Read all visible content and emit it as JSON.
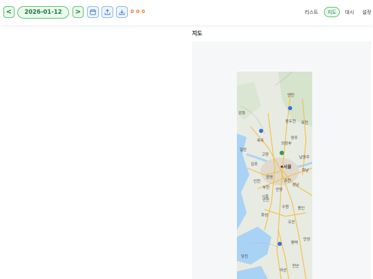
{
  "toolbar": {
    "prev_label": "<",
    "date": "2026-01-12",
    "next_label": ">",
    "icons": [
      "calendar-icon",
      "upload-icon",
      "download-icon"
    ],
    "counts": [
      "0",
      "0",
      "0"
    ],
    "counts_color": "#e8752e"
  },
  "views": {
    "list": "리스트",
    "map": "지도",
    "dashboard": "대시",
    "settings": "설정",
    "active": "map"
  },
  "map_section": {
    "title": "지도",
    "labels": [
      "연천",
      "포천",
      "동두천",
      "양주",
      "파주",
      "의정부",
      "고양",
      "남양주",
      "서울",
      "하남",
      "김포",
      "인천",
      "광명",
      "과천",
      "성남",
      "안양",
      "부천",
      "시흥",
      "안산",
      "수원",
      "화성",
      "용인",
      "오산",
      "평택",
      "안성",
      "당진",
      "아산",
      "천안",
      "강화",
      "일산"
    ]
  },
  "colors": {
    "accent_green": "#5cc16f",
    "accent_blue": "#8ab4e6",
    "water": "#a9d3f5",
    "land": "#e8ebe2",
    "road": "#f2c14e"
  }
}
